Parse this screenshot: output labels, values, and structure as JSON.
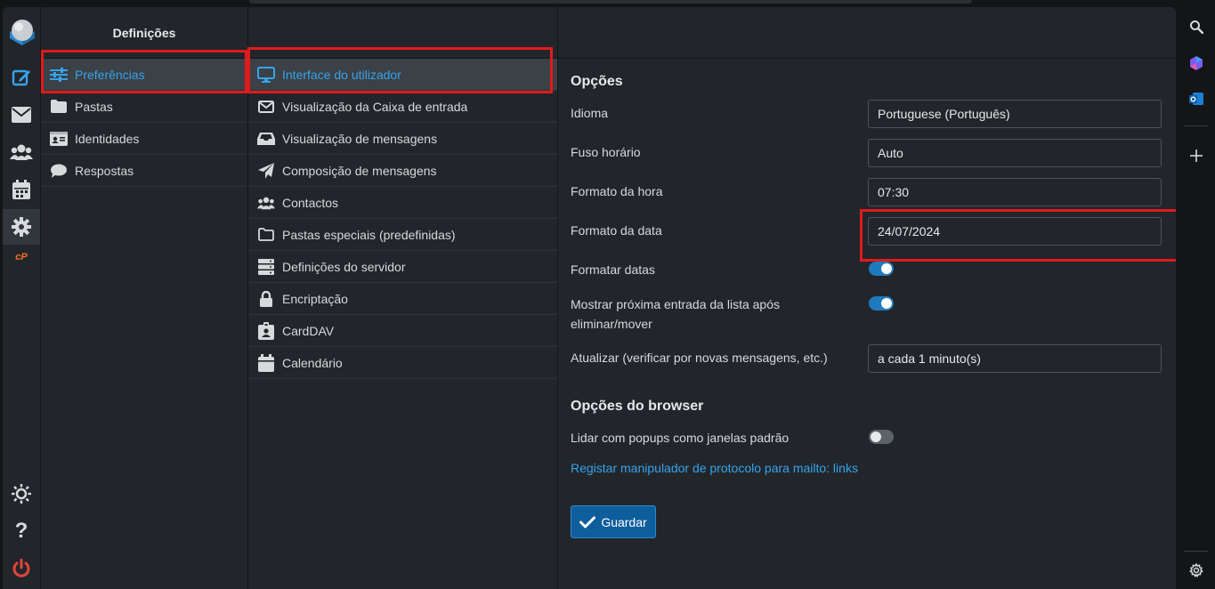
{
  "sidebar_title": "Definições",
  "settings_sections": [
    {
      "label": "Preferências",
      "icon": "sliders-icon"
    },
    {
      "label": "Pastas",
      "icon": "folder-icon"
    },
    {
      "label": "Identidades",
      "icon": "id-card-icon"
    },
    {
      "label": "Respostas",
      "icon": "comment-icon"
    }
  ],
  "preference_sections": [
    {
      "label": "Interface do utilizador",
      "icon": "monitor-icon"
    },
    {
      "label": "Visualização da Caixa de entrada",
      "icon": "envelope-icon"
    },
    {
      "label": "Visualização de mensagens",
      "icon": "inbox-icon"
    },
    {
      "label": "Composição de mensagens",
      "icon": "paper-plane-icon"
    },
    {
      "label": "Contactos",
      "icon": "users-icon"
    },
    {
      "label": "Pastas especiais (predefinidas)",
      "icon": "folder-outline-icon"
    },
    {
      "label": "Definições do servidor",
      "icon": "server-icon"
    },
    {
      "label": "Encriptação",
      "icon": "lock-icon"
    },
    {
      "label": "CardDAV",
      "icon": "badge-icon"
    },
    {
      "label": "Calendário",
      "icon": "calendar-icon"
    }
  ],
  "options": {
    "title": "Opções",
    "language_label": "Idioma",
    "language_value": "Portuguese (Português)",
    "timezone_label": "Fuso horário",
    "timezone_value": "Auto",
    "time_format_label": "Formato da hora",
    "time_format_value": "07:30",
    "date_format_label": "Formato da data",
    "date_format_value": "24/07/2024",
    "pretty_dates_label": "Formatar datas",
    "pretty_dates_on": true,
    "display_next_label_line1": "Mostrar próxima entrada da lista após",
    "display_next_label_line2": "eliminar/mover",
    "display_next_on": true,
    "refresh_label": "Atualizar (verificar por novas mensagens, etc.)",
    "refresh_value": "a cada 1 minuto(s)"
  },
  "browser_options": {
    "title": "Opções do browser",
    "popups_label": "Lidar com popups como janelas padrão",
    "popups_on": false,
    "mailto_link": "Registar manipulador de protocolo para mailto: links"
  },
  "save_label": "Guardar",
  "colors": {
    "accent": "#36a3ec",
    "highlight_box": "#e01b1b",
    "logout": "#e0453a",
    "button": "#0f5e9c"
  }
}
